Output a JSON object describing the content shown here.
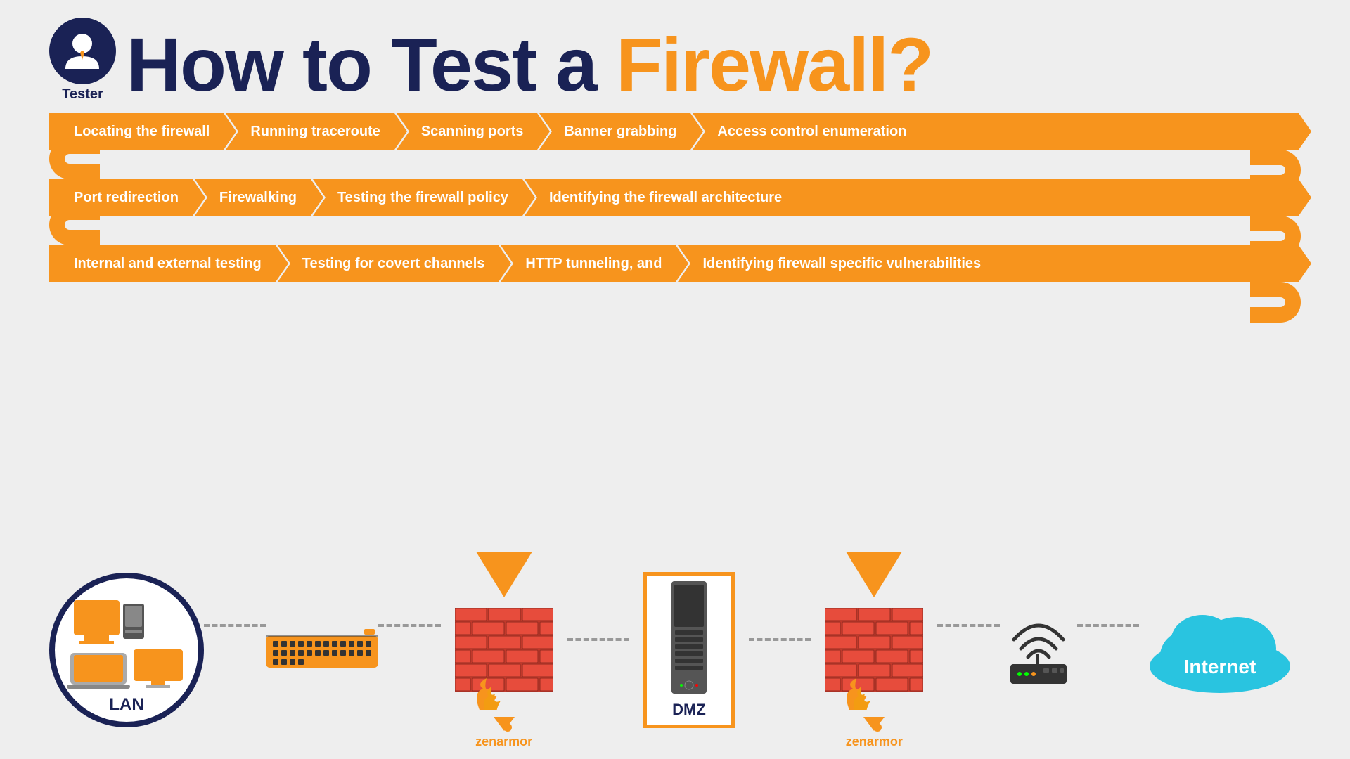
{
  "title": {
    "prefix": "How to Test a ",
    "highlight": "Firewall?",
    "tester_label": "Tester"
  },
  "rows": [
    {
      "id": "row1",
      "steps": [
        "Locating the firewall",
        "Running traceroute",
        "Scanning ports",
        "Banner grabbing",
        "Access control enumeration"
      ]
    },
    {
      "id": "row2",
      "steps": [
        "Port redirection",
        "Firewalking",
        "Testing the firewall policy",
        "Identifying the firewall architecture"
      ]
    },
    {
      "id": "row3",
      "steps": [
        "Internal and external testing",
        "Testing for covert channels",
        "HTTP tunneling, and",
        "Identifying firewall specific vulnerabilities"
      ]
    }
  ],
  "diagram": {
    "lan_label": "LAN",
    "dmz_label": "DMZ",
    "internet_label": "Internet",
    "brand_label": "zenarmor",
    "brand_label2": "zenarmor"
  },
  "colors": {
    "orange": "#f7941d",
    "navy": "#1a2255",
    "cloud_blue": "#29c4e0",
    "background": "#eeeeee"
  }
}
